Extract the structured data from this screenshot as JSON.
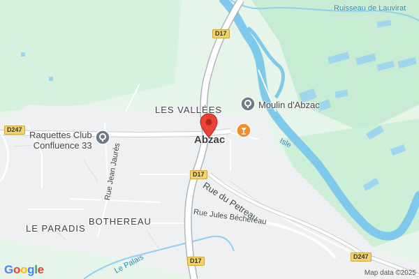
{
  "map": {
    "places": {
      "les_vallees": "LES VALLÉES",
      "le_paradis": "LE PARADIS",
      "bothereau": "BOTHEREAU"
    },
    "town": "Abzac",
    "roads": {
      "d17": "D17",
      "d247": "D247"
    },
    "streets": {
      "rue_du_petreau": "Rue du Petreau",
      "rue_jean_jaures": "Rue Jean Jaurès",
      "rue_jules_bechereau": "Rue Jules Béchereau"
    },
    "water": {
      "ruisseau": "Ruisseau de Lauvirat",
      "isle": "Isle",
      "le_palais": "Le Palais"
    },
    "pois": {
      "moulin": "Moulin d'Abzac",
      "raquettes_line1": "Raquettes Club",
      "raquettes_line2": "Confluence 33"
    },
    "footer": {
      "attribution": "Map data ©2025",
      "logo": "Google"
    },
    "colors": {
      "water": "#7fc9ea",
      "park": "#c8ecd3",
      "urban": "#eef0f1",
      "road": "#ffffff",
      "pin": "#ea4335",
      "poi_orange": "#f28c28",
      "poi_gray": "#6f7b86"
    }
  }
}
